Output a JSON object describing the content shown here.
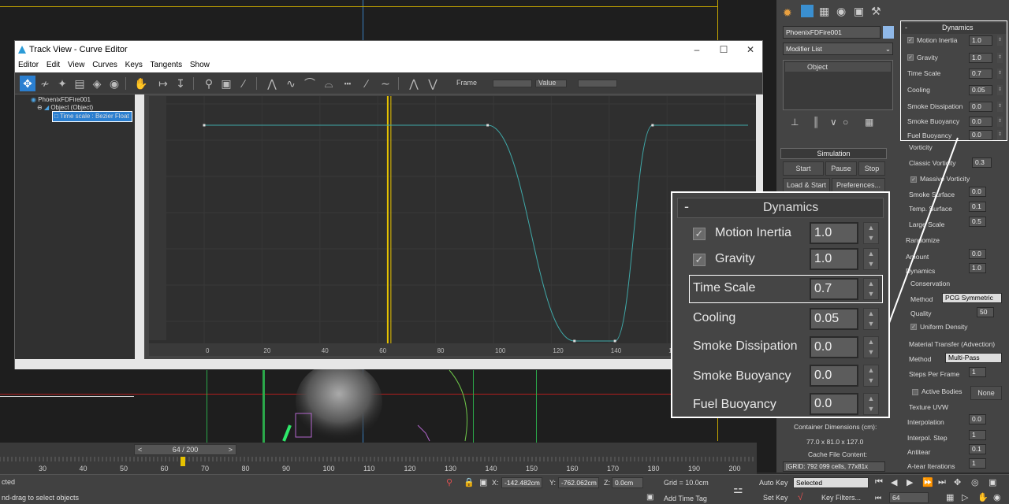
{
  "track_view": {
    "title": "Track View - Curve Editor",
    "menu": [
      "Editor",
      "Edit",
      "View",
      "Curves",
      "Keys",
      "Tangents",
      "Show"
    ],
    "frame_label": "Frame",
    "value_label": "Value",
    "tree": {
      "root": "PhoenixFDFire001",
      "object": "Object (Object)",
      "selected": "Time scale : Bezier Float"
    },
    "ruler_ticks": [
      "0",
      "20",
      "40",
      "60",
      "80",
      "100",
      "120",
      "140",
      "160"
    ]
  },
  "command_panel": {
    "object_name": "PhoenixFDFire001",
    "modifier_list": "Modifier List",
    "stack_item": "Object",
    "simulation": {
      "header": "Simulation",
      "start": "Start",
      "pause": "Pause",
      "stop": "Stop",
      "load_start": "Load & Start",
      "preferences": "Preferences..."
    },
    "dynamics": {
      "header": "Dynamics",
      "motion_inertia": "Motion Inertia",
      "motion_inertia_val": "1.0",
      "gravity": "Gravity",
      "gravity_val": "1.0",
      "time_scale": "Time Scale",
      "time_scale_val": "0.7",
      "cooling": "Cooling",
      "cooling_val": "0.05",
      "smoke_dissipation": "Smoke Dissipation",
      "smoke_dissipation_val": "0.0",
      "smoke_buoyancy": "Smoke Buoyancy",
      "smoke_buoyancy_val": "0.0",
      "fuel_buoyancy": "Fuel Buoyancy",
      "fuel_buoyancy_val": "0.0"
    },
    "vorticity": {
      "header": "Vorticity",
      "classic": "Classic Vorticity",
      "classic_val": "0.3",
      "massive": "Massive Vorticity",
      "smoke_surface": "Smoke Surface",
      "smoke_surface_val": "0.0",
      "temp_surface": "Temp. Surface",
      "temp_surface_val": "0.1",
      "large_scale": "Large Scale",
      "large_scale_val": "0.5"
    },
    "randomize": {
      "header": "Randomize",
      "amount": "Amount",
      "amount_val": "0.0",
      "dynamics": "Dynamics",
      "dynamics_val": "1.0"
    },
    "conservation": {
      "header": "Conservation",
      "method": "Method",
      "method_val": "PCG Symmetric",
      "quality": "Quality",
      "quality_val": "50",
      "uniform_density": "Uniform Density"
    },
    "material_transfer": {
      "header": "Material Transfer (Advection)",
      "method": "Method",
      "method_val": "Multi-Pass",
      "steps": "Steps Per Frame",
      "steps_val": "1"
    },
    "active_bodies": "Active Bodies",
    "active_bodies_val": "None",
    "texture_uvw": {
      "header": "Texture UVW",
      "interpolation": "Interpolation",
      "interpolation_val": "0.0",
      "interp_step": "Interpol. Step",
      "interp_step_val": "1",
      "antitear": "Antitear",
      "antitear_val": "0.1",
      "atear_iter": "A-tear Iterations",
      "atear_iter_val": "1"
    },
    "container": {
      "dims_label": "Container Dimensions (cm):",
      "dims": "77.0 x 81.0 x 127.0",
      "cache_label": "Cache File Content:",
      "grid": "[GRID: 792 099 cells, 77x81x"
    }
  },
  "timeline": {
    "frame_counter": "64 / 200",
    "ticks": [
      "30",
      "40",
      "50",
      "60",
      "70",
      "80",
      "90",
      "100",
      "110",
      "120",
      "130",
      "140",
      "150",
      "160",
      "170",
      "180",
      "190",
      "200"
    ]
  },
  "status": {
    "line1": "cted",
    "line2": "nd-drag to select objects",
    "x_label": "X:",
    "x_val": "-142.482cm",
    "y_label": "Y:",
    "y_val": "-762.062cm",
    "z_label": "Z:",
    "z_val": "0.0cm",
    "grid": "Grid = 10.0cm",
    "add_time_tag": "Add Time Tag",
    "auto_key": "Auto Key",
    "set_key": "Set Key",
    "selected": "Selected",
    "key_filters": "Key Filters...",
    "frame": "64"
  },
  "curve_data": {
    "frames": [
      0,
      20,
      40,
      60,
      80,
      100,
      120,
      140,
      160
    ],
    "keys": [
      {
        "frame": 0,
        "value": 1.0
      },
      {
        "frame": 98,
        "value": 1.0
      },
      {
        "frame": 128,
        "value": 0.0
      },
      {
        "frame": 142,
        "value": 0.0
      },
      {
        "frame": 155,
        "value": 1.0
      }
    ],
    "current_frame": 64,
    "colors": {
      "curve": "#3fa8a8",
      "time_slider": "#e6c200",
      "selection": "#2b7fd0"
    }
  }
}
